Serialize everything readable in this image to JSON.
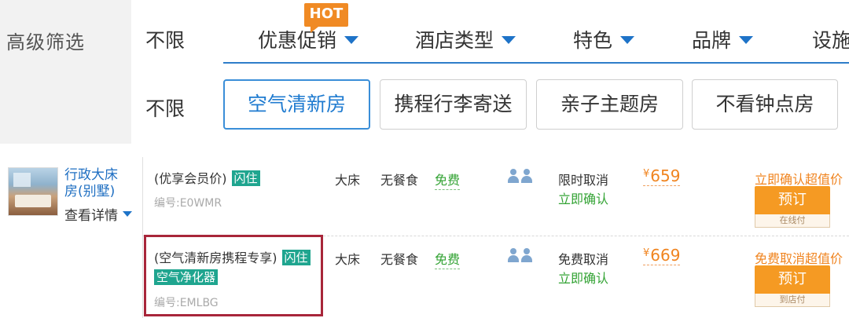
{
  "filter": {
    "title": "高级筛选",
    "row1": {
      "unlimited": "不限",
      "hot_badge": "HOT",
      "categories": [
        "优惠促销",
        "酒店类型",
        "特色",
        "品牌",
        "设施"
      ]
    },
    "row2": {
      "unlimited": "不限",
      "chips": [
        "空气清新房",
        "携程行李寄送",
        "亲子主题房",
        "不看钟点房"
      ],
      "active_chip": "空气清新房"
    }
  },
  "room": {
    "name": "行政大床房(别墅)",
    "detail_link": "查看详情",
    "rates": [
      {
        "plan": "(优享会员价)",
        "tags": [
          "闪住"
        ],
        "extra_tag": "",
        "code": "编号:E0WMR",
        "bed": "大床",
        "breakfast": "无餐食",
        "wifi": "免费",
        "cancel": "限时取消",
        "confirm": "立即确认",
        "currency": "¥",
        "price": "659",
        "promo": "立即确认超值价",
        "book": "预订",
        "pay": "在线付"
      },
      {
        "plan": "(空气清新房携程专享)",
        "tags": [
          "闪住"
        ],
        "extra_tag": "空气净化器",
        "code": "编号:EMLBG",
        "bed": "大床",
        "breakfast": "无餐食",
        "wifi": "免费",
        "cancel": "免费取消",
        "confirm": "立即确认",
        "currency": "¥",
        "price": "669",
        "promo": "免费取消超值价",
        "book": "预订",
        "pay": "到店付"
      }
    ]
  },
  "colors": {
    "accent_blue": "#1e73c8",
    "orange": "#f59a23",
    "green": "#33a334",
    "teal_tag": "#1fa58f",
    "highlight": "#a8263a"
  }
}
